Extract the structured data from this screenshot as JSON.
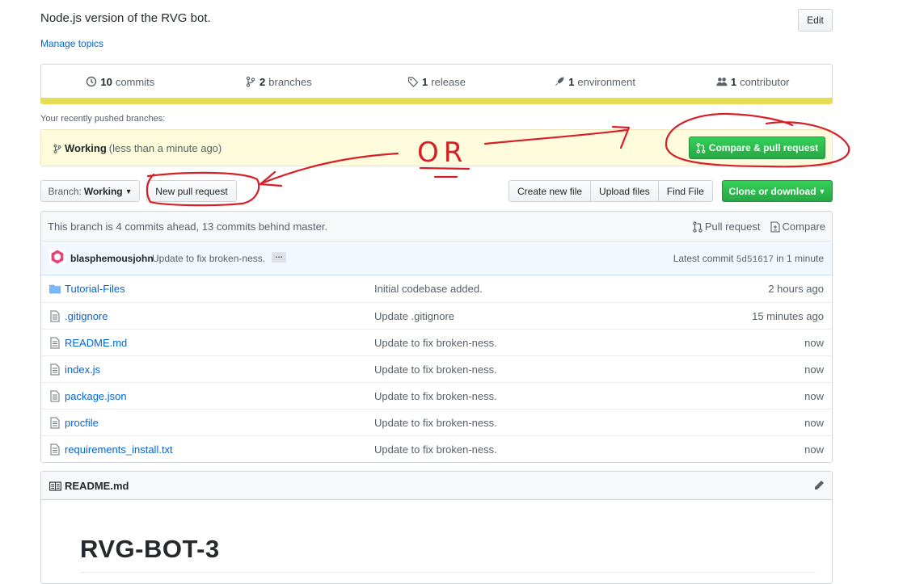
{
  "repo": {
    "description": "Node.js version of the RVG bot.",
    "manage_topics": "Manage topics",
    "edit_label": "Edit"
  },
  "summary": {
    "commits_count": "10",
    "commits_label": "commits",
    "branches_count": "2",
    "branches_label": "branches",
    "releases_count": "1",
    "releases_label": "release",
    "environments_count": "1",
    "environments_label": "environment",
    "contributors_count": "1",
    "contributors_label": "contributor",
    "language_color": "#e9dc55"
  },
  "recent": {
    "label": "Your recently pushed branches:",
    "branch": "Working",
    "time": "(less than a minute ago)",
    "compare_label": "Compare & pull request"
  },
  "toolbar": {
    "branch_prefix": "Branch:",
    "branch_name": "Working",
    "new_pr_label": "New pull request",
    "create_file_label": "Create new file",
    "upload_label": "Upload files",
    "find_label": "Find File",
    "clone_label": "Clone or download"
  },
  "tracker": {
    "message": "This branch is 4 commits ahead, 13 commits behind master.",
    "pull_request_label": "Pull request",
    "compare_label": "Compare"
  },
  "commit": {
    "author": "blasphemousjohn",
    "message": "Update to fix broken-ness.",
    "ellipsis": "…",
    "latest_prefix": "Latest commit",
    "sha": "5d51617",
    "time": "in 1 minute"
  },
  "files": [
    {
      "name": "Tutorial-Files",
      "type": "folder",
      "message": "Initial codebase added.",
      "age": "2 hours ago"
    },
    {
      "name": ".gitignore",
      "type": "file",
      "message": "Update .gitignore",
      "age": "15 minutes ago"
    },
    {
      "name": "README.md",
      "type": "file",
      "message": "Update to fix broken-ness.",
      "age": "now"
    },
    {
      "name": "index.js",
      "type": "file",
      "message": "Update to fix broken-ness.",
      "age": "now"
    },
    {
      "name": "package.json",
      "type": "file",
      "message": "Update to fix broken-ness.",
      "age": "now"
    },
    {
      "name": "procfile",
      "type": "file",
      "message": "Update to fix broken-ness.",
      "age": "now"
    },
    {
      "name": "requirements_install.txt",
      "type": "file",
      "message": "Update to fix broken-ness.",
      "age": "now"
    }
  ],
  "readme": {
    "header": "README.md",
    "heading": "RVG-BOT-3"
  },
  "annotation": {
    "text": "OR",
    "color": "#d61f26"
  }
}
